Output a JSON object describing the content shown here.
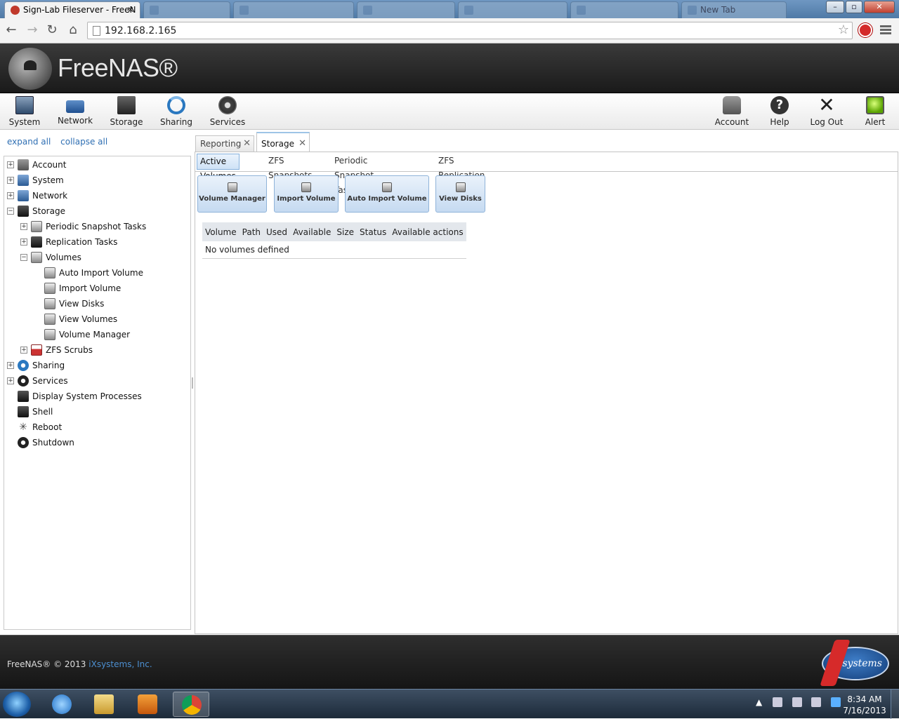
{
  "browser": {
    "active_tab_title": "Sign-Lab Fileserver - FreeN",
    "other_tabs": [
      "",
      "",
      "",
      "",
      "",
      "",
      "New Tab"
    ],
    "url": "192.168.2.165"
  },
  "freenas": {
    "brand": "FreeNAS®",
    "nav_left": [
      "System",
      "Network",
      "Storage",
      "Sharing",
      "Services"
    ],
    "nav_right": [
      "Account",
      "Help",
      "Log Out",
      "Alert"
    ]
  },
  "tree": {
    "expand_all": "expand all",
    "collapse_all": "collapse all",
    "nodes": [
      {
        "label": "Account"
      },
      {
        "label": "System"
      },
      {
        "label": "Network"
      },
      {
        "label": "Storage"
      },
      {
        "label": "Periodic Snapshot Tasks"
      },
      {
        "label": "Replication Tasks"
      },
      {
        "label": "Volumes"
      },
      {
        "label": "Auto Import Volume"
      },
      {
        "label": "Import Volume"
      },
      {
        "label": "View Disks"
      },
      {
        "label": "View Volumes"
      },
      {
        "label": "Volume Manager"
      },
      {
        "label": "ZFS Scrubs"
      },
      {
        "label": "Sharing"
      },
      {
        "label": "Services"
      },
      {
        "label": "Display System Processes"
      },
      {
        "label": "Shell"
      },
      {
        "label": "Reboot"
      },
      {
        "label": "Shutdown"
      }
    ]
  },
  "content": {
    "tabs": [
      "Reporting",
      "Storage"
    ],
    "subtabs": [
      "Active Volumes",
      "ZFS Snapshots",
      "Periodic Snapshot Tasks",
      "ZFS Replication"
    ],
    "action_buttons": [
      "Volume Manager",
      "Import Volume",
      "Auto Import Volume",
      "View Disks"
    ],
    "table": {
      "columns": [
        "Volume",
        "Path",
        "Used",
        "Available",
        "Size",
        "Status",
        "Available actions"
      ],
      "empty_message": "No volumes defined"
    }
  },
  "footer": {
    "copyright": "FreeNAS® © 2013",
    "company_link": "iXsystems, Inc.",
    "logo_text": "systems"
  },
  "taskbar": {
    "time": "8:34 AM",
    "date": "7/16/2013"
  }
}
